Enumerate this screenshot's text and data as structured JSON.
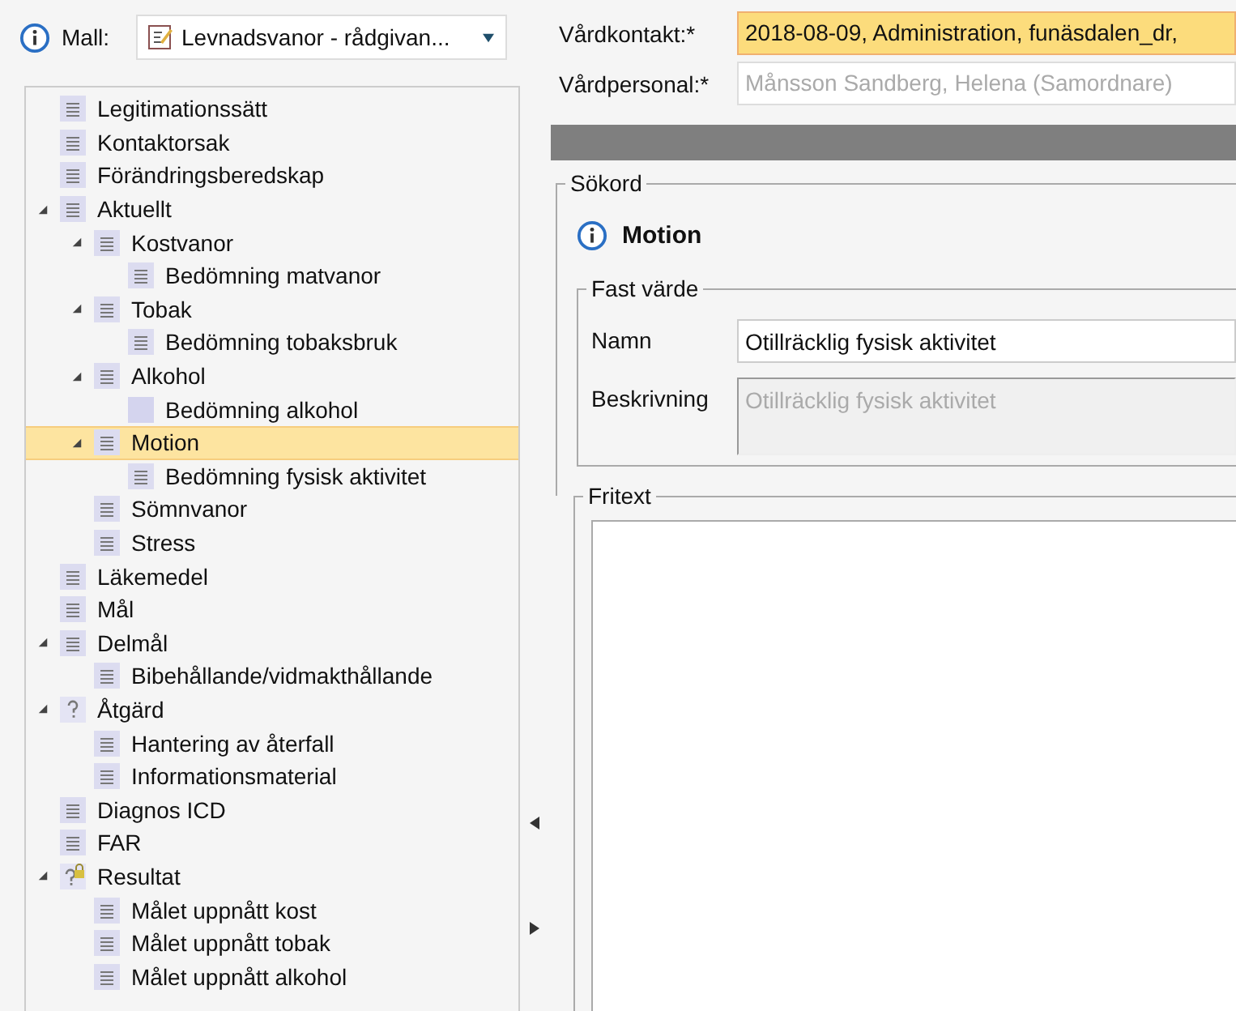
{
  "template": {
    "label": "Mall:",
    "value": "Levnadsvanor - rådgivan..."
  },
  "tree": [
    {
      "label": "Legitimationssätt",
      "kind": "document",
      "selected": false
    },
    {
      "label": "Kontaktorsak",
      "kind": "document",
      "selected": false
    },
    {
      "label": "Förändringsberedskap",
      "kind": "document",
      "selected": false
    },
    {
      "label": "Aktuellt",
      "kind": "document",
      "selected": false,
      "expanded": true,
      "children": [
        {
          "label": "Kostvanor",
          "kind": "document",
          "selected": false,
          "expanded": true,
          "children": [
            {
              "label": "Bedömning matvanor",
              "kind": "document",
              "selected": false
            }
          ]
        },
        {
          "label": "Tobak",
          "kind": "document",
          "selected": false,
          "expanded": true,
          "children": [
            {
              "label": "Bedömning tobaksbruk",
              "kind": "document",
              "selected": false
            }
          ]
        },
        {
          "label": "Alkohol",
          "kind": "document",
          "selected": false,
          "expanded": true,
          "children": [
            {
              "label": "Bedömning alkohol",
              "kind": "blank",
              "selected": false
            }
          ]
        },
        {
          "label": "Motion",
          "kind": "document",
          "selected": true,
          "expanded": true,
          "children": [
            {
              "label": "Bedömning fysisk aktivitet",
              "kind": "document",
              "selected": false
            }
          ]
        },
        {
          "label": "Sömnvanor",
          "kind": "document",
          "selected": false
        },
        {
          "label": "Stress",
          "kind": "document",
          "selected": false
        }
      ]
    },
    {
      "label": "Läkemedel",
      "kind": "document",
      "selected": false
    },
    {
      "label": "Mål",
      "kind": "document",
      "selected": false
    },
    {
      "label": "Delmål",
      "kind": "document",
      "selected": false,
      "expanded": true,
      "children": [
        {
          "label": "Bibehållande/vidmakthållande",
          "kind": "document",
          "selected": false
        }
      ]
    },
    {
      "label": "Åtgärd",
      "kind": "question",
      "selected": false,
      "expanded": true,
      "children": [
        {
          "label": "Hantering av återfall",
          "kind": "document",
          "selected": false
        },
        {
          "label": "Informationsmaterial",
          "kind": "document",
          "selected": false
        }
      ]
    },
    {
      "label": "Diagnos ICD",
      "kind": "document",
      "selected": false
    },
    {
      "label": "FAR",
      "kind": "document",
      "selected": false
    },
    {
      "label": "Resultat",
      "kind": "locked",
      "selected": false,
      "expanded": true,
      "children": [
        {
          "label": "Målet uppnått kost",
          "kind": "document",
          "selected": false
        },
        {
          "label": "Målet uppnått tobak",
          "kind": "document",
          "selected": false
        },
        {
          "label": "Målet uppnått alkohol",
          "kind": "document",
          "selected": false
        }
      ]
    }
  ],
  "header": {
    "contact_label": "Vårdkontakt:*",
    "contact_value": "2018-08-09, Administration, funäsdalen_dr,",
    "staff_label": "Vårdpersonal:*",
    "staff_value": "Månsson Sandberg, Helena (Samordnare)"
  },
  "keyword": {
    "legend": "Sökord",
    "title": "Motion",
    "fixed_value": {
      "legend": "Fast värde",
      "name_label": "Namn",
      "name_value": "Otillräcklig fysisk aktivitet",
      "description_label": "Beskrivning",
      "description_value": "Otillräcklig fysisk aktivitet"
    }
  },
  "free_text": {
    "legend": "Fritext"
  }
}
